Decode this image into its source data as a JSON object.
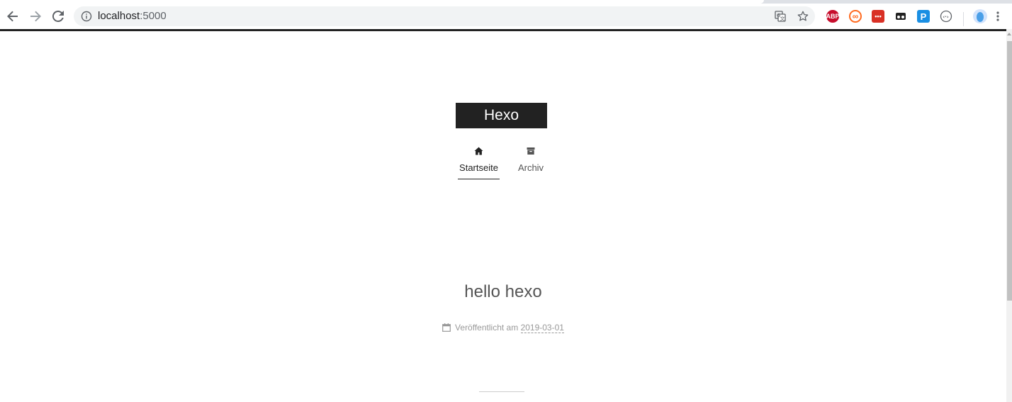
{
  "browser": {
    "url_host": "localhost",
    "url_port": ":5000",
    "icons": [
      "back-icon",
      "forward-icon",
      "reload-icon",
      "info-icon",
      "translate-icon",
      "star-icon",
      "menu-icon"
    ],
    "extensions": [
      {
        "name": "adblock-plus-extension",
        "label": "ABP",
        "color": "#c70d2c"
      },
      {
        "name": "infinity-extension",
        "label": "∞",
        "color": "#ff6a1f"
      },
      {
        "name": "more-extension",
        "label": "•••",
        "color": "#d93025"
      },
      {
        "name": "glasses-extension",
        "label": "",
        "color": "#222222"
      },
      {
        "name": "p-extension",
        "label": "P",
        "color": "#1a8fe3"
      },
      {
        "name": "code-extension",
        "label": "",
        "color": "#5f6368"
      }
    ]
  },
  "site": {
    "brand": "Hexo",
    "menu": [
      {
        "label": "Startseite",
        "icon": "home-icon",
        "active": true
      },
      {
        "label": "Archiv",
        "icon": "archive-icon",
        "active": false
      }
    ]
  },
  "post": {
    "title": "hello hexo",
    "meta_label": "Veröffentlicht am",
    "date": "2019-03-01"
  },
  "colors": {
    "brand_bg": "#222222",
    "text": "#555555",
    "meta": "#999999"
  }
}
